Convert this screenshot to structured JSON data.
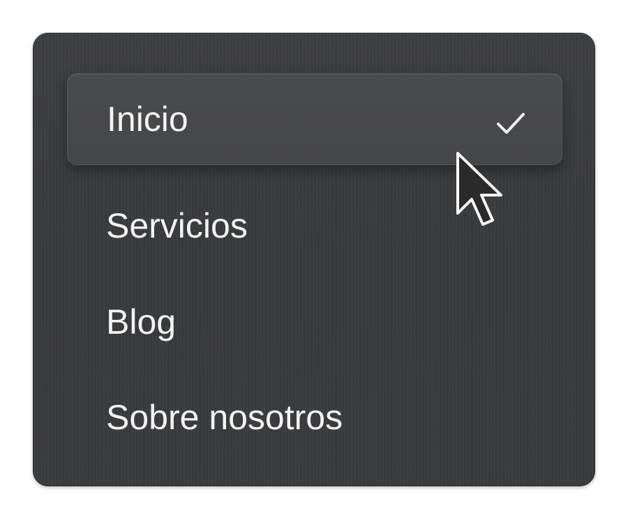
{
  "menu": {
    "items": [
      {
        "label": "Inicio",
        "selected": true
      },
      {
        "label": "Servicios",
        "selected": false
      },
      {
        "label": "Blog",
        "selected": false
      },
      {
        "label": "Sobre nosotros",
        "selected": false
      }
    ],
    "selected_indicator_icon": "checkmark-icon",
    "pointer_icon": "mouse-pointer-icon"
  },
  "colors": {
    "menu_background": "#3a3b3d",
    "selected_item_background": "#474849",
    "text": "#f3f3f3",
    "cursor_fill": "#2a2a2a",
    "cursor_outline": "#ffffff"
  }
}
